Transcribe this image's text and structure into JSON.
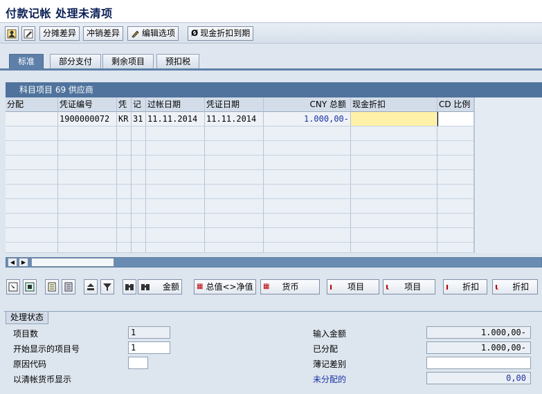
{
  "window": {
    "title": "付款记帐 处理未清项"
  },
  "toolbar": {
    "buttons": [
      {
        "label": "分摊差异"
      },
      {
        "label": "冲销差异"
      },
      {
        "label": "编辑选项"
      },
      {
        "label": "现金折扣到期"
      }
    ]
  },
  "tabs": [
    "标准",
    "部分支付",
    "剩余项目",
    "预扣税"
  ],
  "table": {
    "title": "科目项目 69 供应商",
    "headers": [
      "分配",
      "凭证编号",
      "凭",
      "记",
      "过帐日期",
      "凭证日期",
      "CNY 总额",
      "现金折扣",
      "CD 比例"
    ],
    "rows": [
      [
        "",
        "1900000072",
        "KR",
        "31",
        "11.11.2014",
        "11.11.2014",
        "1.000,00-",
        "",
        ""
      ]
    ]
  },
  "bottom_toolbar": {
    "amount_label": "金额",
    "gross_net_label": "总值<>净值",
    "currency_label": "货币",
    "item_label_1": "项目",
    "item_label_2": "项目",
    "discount_label_1": "折扣",
    "discount_label_2": "折扣"
  },
  "status": {
    "title": "处理状态",
    "item_count_label": "项目数",
    "item_count_value": "1",
    "first_item_label": "开始显示的项目号",
    "first_item_value": "1",
    "reason_code_label": "原因代码",
    "reason_code_value": "",
    "clearing_currency_label": "以清帐货币显示",
    "entered_amount_label": "输入金额",
    "entered_amount_value": "1.000,00-",
    "assigned_label": "已分配",
    "assigned_value": "1.000,00-",
    "diff_label": "薄记差别",
    "diff_value": "",
    "unassigned_label": "未分配的",
    "unassigned_value": "0,00"
  },
  "colors": {
    "accent": "#5d7fa8",
    "highlight": "#fff1a8",
    "number_blue": "#1a33a3"
  }
}
